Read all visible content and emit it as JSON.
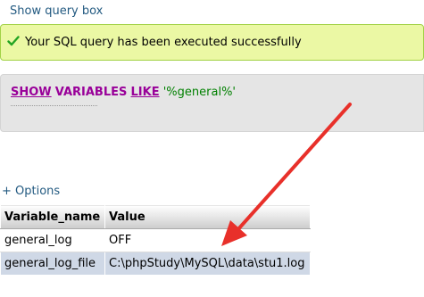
{
  "links": {
    "show_query_box": "Show query box",
    "options": "+ Options"
  },
  "success": {
    "message": "Your SQL query has been executed successfully",
    "icon": "check-icon",
    "color": "#22a422"
  },
  "sql": {
    "keyword_show": "SHOW",
    "keyword_variables": "VARIABLES",
    "keyword_like": "LIKE",
    "pattern": "'%general%'"
  },
  "table": {
    "headers": [
      "Variable_name",
      "Value"
    ],
    "rows": [
      {
        "name": "general_log",
        "value": "OFF"
      },
      {
        "name": "general_log_file",
        "value": "C:\\phpStudy\\MySQL\\data\\stu1.log"
      }
    ]
  },
  "annotation": {
    "color": "#e8302a"
  }
}
